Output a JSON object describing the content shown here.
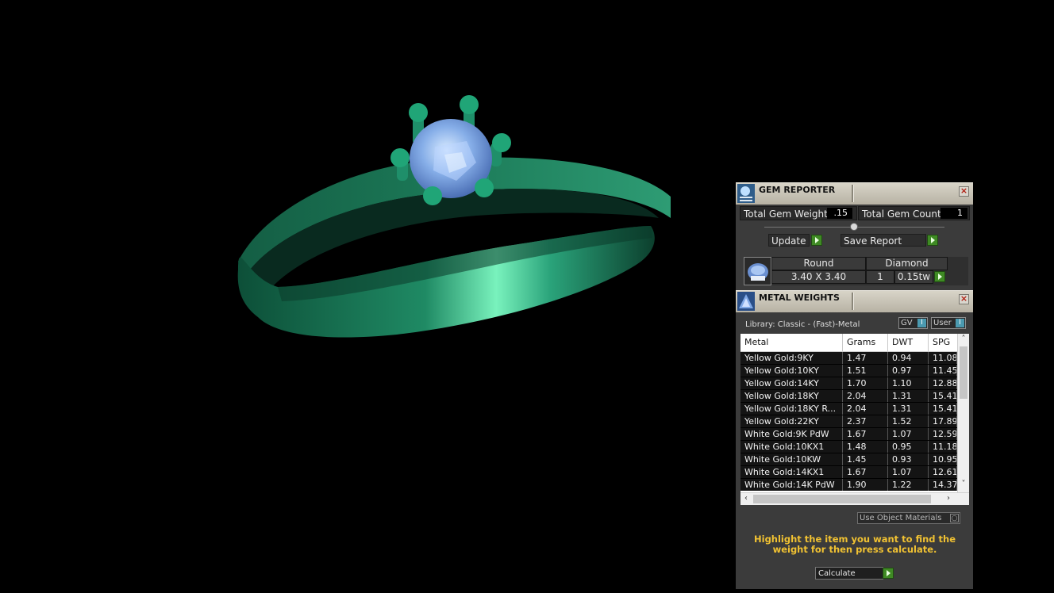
{
  "gem_reporter": {
    "title": "GEM REPORTER",
    "total_gem_weight_label": "Total Gem Weight",
    "total_gem_weight_value": ".15",
    "total_gem_count_label": "Total Gem Count",
    "total_gem_count_value": "1",
    "update_label": "Update",
    "save_report_label": "Save Report",
    "gem": {
      "shape": "Round",
      "type": "Diamond",
      "size": "3.40 X 3.40",
      "count": "1",
      "weight": "0.15tw"
    }
  },
  "metal_weights": {
    "title": "METAL WEIGHTS",
    "library": "Library: Classic - (Fast)-Metal",
    "toggle_gv": "GV",
    "toggle_user": "User",
    "columns": [
      "Metal",
      "Grams",
      "DWT",
      "SPG"
    ],
    "rows": [
      [
        "Yellow Gold:9KY",
        "1.47",
        "0.94",
        "11.08"
      ],
      [
        "Yellow Gold:10KY",
        "1.51",
        "0.97",
        "11.45"
      ],
      [
        "Yellow Gold:14KY",
        "1.70",
        "1.10",
        "12.88"
      ],
      [
        "Yellow Gold:18KY",
        "2.04",
        "1.31",
        "15.41"
      ],
      [
        "Yellow Gold:18KY R...",
        "2.04",
        "1.31",
        "15.41"
      ],
      [
        "Yellow Gold:22KY",
        "2.37",
        "1.52",
        "17.89"
      ],
      [
        "White Gold:9K PdW",
        "1.67",
        "1.07",
        "12.59"
      ],
      [
        "White Gold:10KX1",
        "1.48",
        "0.95",
        "11.18"
      ],
      [
        "White Gold:10KW",
        "1.45",
        "0.93",
        "10.95"
      ],
      [
        "White Gold:14KX1",
        "1.67",
        "1.07",
        "12.61"
      ],
      [
        "White Gold:14K PdW",
        "1.90",
        "1.22",
        "14.37"
      ]
    ],
    "use_object_materials": "Use Object Materials",
    "hint": "Highlight the item you want to find the weight for then press calculate.",
    "calculate_label": "Calculate"
  },
  "colors": {
    "ring": "#1f8a64",
    "gem": "#7aa6e8",
    "hint": "#f1c232",
    "play": "#3f8a24"
  }
}
